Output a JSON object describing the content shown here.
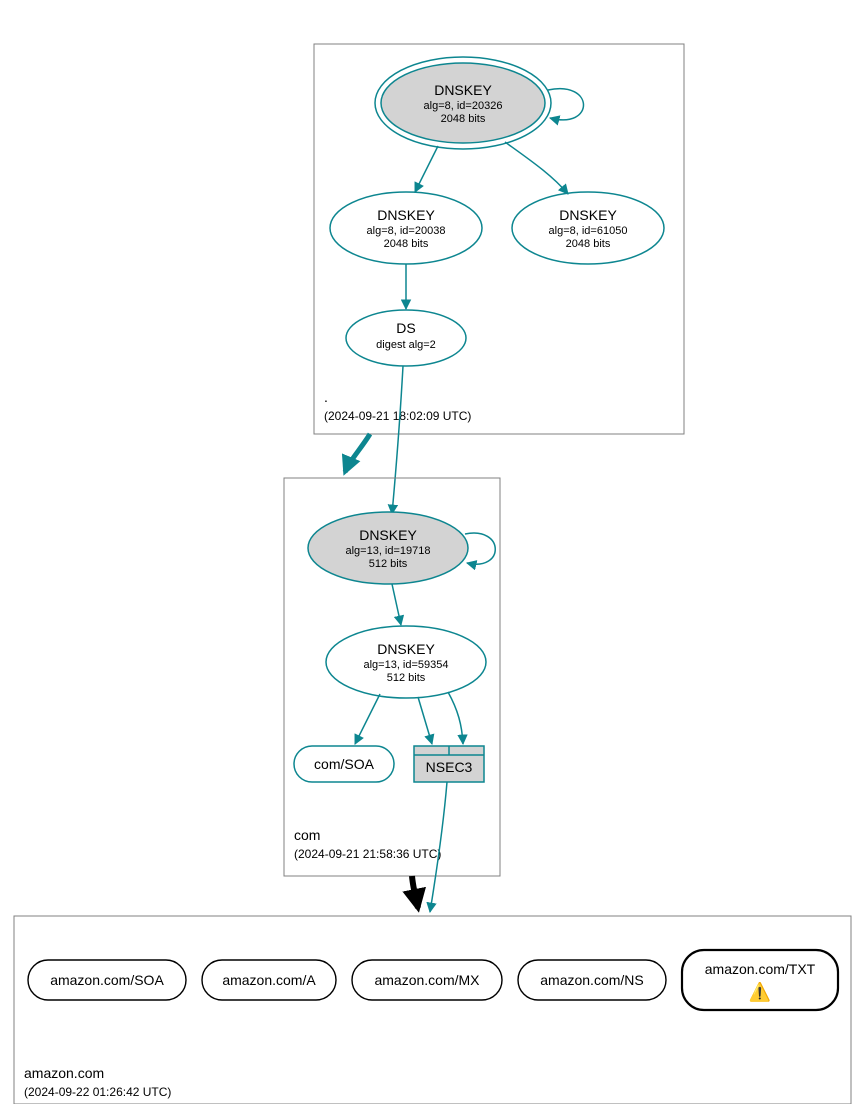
{
  "zones": {
    "root": {
      "label": ".",
      "timestamp": "(2024-09-21 18:02:09 UTC)"
    },
    "com": {
      "label": "com",
      "timestamp": "(2024-09-21 21:58:36 UTC)"
    },
    "amazon": {
      "label": "amazon.com",
      "timestamp": "(2024-09-22 01:26:42 UTC)"
    }
  },
  "nodes": {
    "root_ksk": {
      "title": "DNSKEY",
      "line2": "alg=8, id=20326",
      "line3": "2048 bits"
    },
    "root_zsk1": {
      "title": "DNSKEY",
      "line2": "alg=8, id=20038",
      "line3": "2048 bits"
    },
    "root_zsk2": {
      "title": "DNSKEY",
      "line2": "alg=8, id=61050",
      "line3": "2048 bits"
    },
    "root_ds": {
      "title": "DS",
      "line2": "digest alg=2"
    },
    "com_ksk": {
      "title": "DNSKEY",
      "line2": "alg=13, id=19718",
      "line3": "512 bits"
    },
    "com_zsk": {
      "title": "DNSKEY",
      "line2": "alg=13, id=59354",
      "line3": "512 bits"
    },
    "com_soa": {
      "title": "com/SOA"
    },
    "com_nsec3": {
      "title": "NSEC3"
    },
    "amazon_soa": {
      "title": "amazon.com/SOA"
    },
    "amazon_a": {
      "title": "amazon.com/A"
    },
    "amazon_mx": {
      "title": "amazon.com/MX"
    },
    "amazon_ns": {
      "title": "amazon.com/NS"
    },
    "amazon_txt": {
      "title": "amazon.com/TXT"
    }
  },
  "warning_glyph": "⚠️",
  "chart_data": {
    "type": "graph",
    "description": "DNSSEC authentication chain / DNSViz-style graph",
    "zones": [
      {
        "name": ".",
        "analyzed": "2024-09-21 18:02:09 UTC"
      },
      {
        "name": "com",
        "analyzed": "2024-09-21 21:58:36 UTC"
      },
      {
        "name": "amazon.com",
        "analyzed": "2024-09-22 01:26:42 UTC"
      }
    ],
    "nodes": [
      {
        "id": "root_ksk",
        "zone": ".",
        "type": "DNSKEY",
        "alg": 8,
        "key_id": 20326,
        "bits": 2048,
        "sep": true,
        "trust_anchor": true
      },
      {
        "id": "root_zsk1",
        "zone": ".",
        "type": "DNSKEY",
        "alg": 8,
        "key_id": 20038,
        "bits": 2048,
        "sep": false
      },
      {
        "id": "root_zsk2",
        "zone": ".",
        "type": "DNSKEY",
        "alg": 8,
        "key_id": 61050,
        "bits": 2048,
        "sep": false
      },
      {
        "id": "root_ds",
        "zone": ".",
        "type": "DS",
        "digest_alg": 2,
        "covers": "com"
      },
      {
        "id": "com_ksk",
        "zone": "com",
        "type": "DNSKEY",
        "alg": 13,
        "key_id": 19718,
        "bits": 512,
        "sep": true
      },
      {
        "id": "com_zsk",
        "zone": "com",
        "type": "DNSKEY",
        "alg": 13,
        "key_id": 59354,
        "bits": 512,
        "sep": false
      },
      {
        "id": "com_soa",
        "zone": "com",
        "type": "RRset",
        "name": "com/SOA"
      },
      {
        "id": "com_nsec3",
        "zone": "com",
        "type": "NSEC3"
      },
      {
        "id": "amazon_soa",
        "zone": "amazon.com",
        "type": "RRset",
        "name": "amazon.com/SOA"
      },
      {
        "id": "amazon_a",
        "zone": "amazon.com",
        "type": "RRset",
        "name": "amazon.com/A"
      },
      {
        "id": "amazon_mx",
        "zone": "amazon.com",
        "type": "RRset",
        "name": "amazon.com/MX"
      },
      {
        "id": "amazon_ns",
        "zone": "amazon.com",
        "type": "RRset",
        "name": "amazon.com/NS"
      },
      {
        "id": "amazon_txt",
        "zone": "amazon.com",
        "type": "RRset",
        "name": "amazon.com/TXT",
        "status": "warning"
      }
    ],
    "edges": [
      {
        "from": "root_ksk",
        "to": "root_ksk",
        "kind": "self-sign"
      },
      {
        "from": "root_ksk",
        "to": "root_zsk1",
        "kind": "signs"
      },
      {
        "from": "root_ksk",
        "to": "root_zsk2",
        "kind": "signs"
      },
      {
        "from": "root_zsk1",
        "to": "root_ds",
        "kind": "signs"
      },
      {
        "from": "root_ds",
        "to": "com_ksk",
        "kind": "ds-to-dnskey"
      },
      {
        "from": "root_zone",
        "to": "com_zone",
        "kind": "delegation"
      },
      {
        "from": "com_ksk",
        "to": "com_ksk",
        "kind": "self-sign"
      },
      {
        "from": "com_ksk",
        "to": "com_zsk",
        "kind": "signs"
      },
      {
        "from": "com_zsk",
        "to": "com_soa",
        "kind": "signs"
      },
      {
        "from": "com_zsk",
        "to": "com_nsec3",
        "kind": "signs"
      },
      {
        "from": "com_ksk",
        "to": "com_nsec3",
        "kind": "signs"
      },
      {
        "from": "com_nsec3",
        "to": "amazon_zone",
        "kind": "insecure-delegation"
      },
      {
        "from": "com_zone",
        "to": "amazon_zone",
        "kind": "delegation"
      }
    ]
  }
}
